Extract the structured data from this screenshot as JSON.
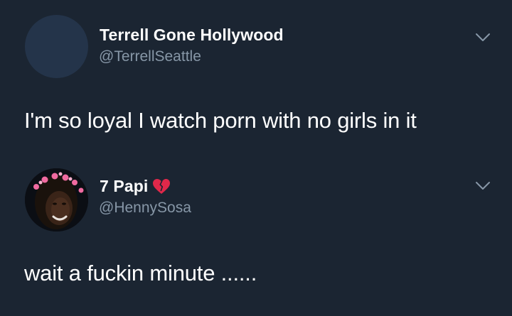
{
  "tweets": [
    {
      "display_name": "Terrell Gone Hollywood",
      "handle": "@TerrellSeattle",
      "text": "I'm so loyal I watch porn with no girls in it",
      "avatar": "blank-avatar",
      "menu_icon": "chevron-down-icon"
    },
    {
      "display_name": "7 Papi",
      "name_emoji": "broken-heart-icon",
      "handle": "@HennySosa",
      "text": "wait a fuckin minute ......",
      "avatar": "photo-avatar",
      "menu_icon": "chevron-down-icon"
    }
  ],
  "colors": {
    "background": "#1b2532",
    "name": "#ffffff",
    "handle": "#8797a7",
    "chevron": "#8797a7",
    "broken_heart": "#e0284a"
  }
}
